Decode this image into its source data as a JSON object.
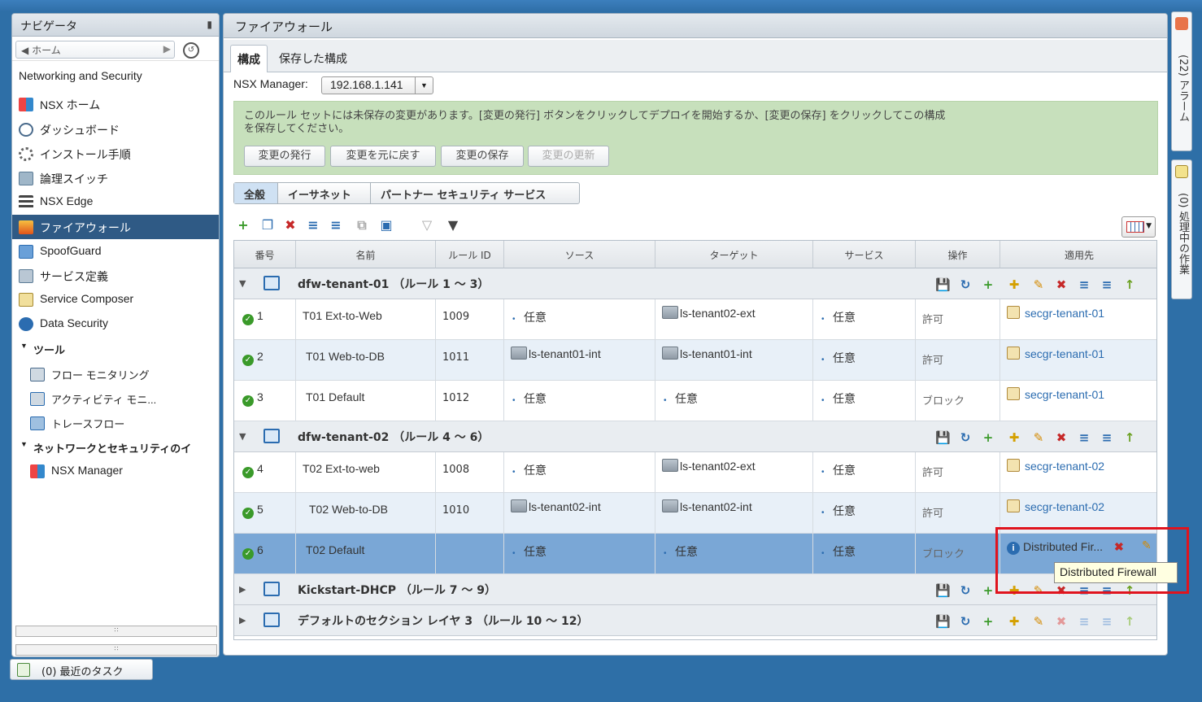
{
  "navigator": {
    "title": "ナビゲータ",
    "home_label": "ホーム",
    "section_title": "Networking and Security",
    "items": [
      {
        "label": "NSX ホーム",
        "icon": "nsx-home-icon"
      },
      {
        "label": "ダッシュボード",
        "icon": "dashboard-icon"
      },
      {
        "label": "インストール手順",
        "icon": "gear-icon"
      },
      {
        "label": "論理スイッチ",
        "icon": "logical-switch-icon"
      },
      {
        "label": "NSX Edge",
        "icon": "nsx-edge-icon"
      },
      {
        "label": "ファイアウォール",
        "icon": "firewall-icon",
        "selected": true
      },
      {
        "label": "SpoofGuard",
        "icon": "spoofguard-icon"
      },
      {
        "label": "サービス定義",
        "icon": "service-definition-icon"
      },
      {
        "label": "Service Composer",
        "icon": "service-composer-icon"
      },
      {
        "label": "Data Security",
        "icon": "data-security-icon"
      }
    ],
    "tools_group": "ツール",
    "tools": [
      {
        "label": "フロー モニタリング",
        "icon": "flow-monitoring-icon"
      },
      {
        "label": "アクティビティ モニ...",
        "icon": "activity-monitoring-icon"
      },
      {
        "label": "トレースフロー",
        "icon": "traceflow-icon"
      }
    ],
    "netsec_group": "ネットワークとセキュリティのイ",
    "netsec_items": [
      {
        "label": "NSX Manager",
        "icon": "nsx-manager-icon"
      }
    ]
  },
  "recent_tasks": "(0) 最近のタスク",
  "main": {
    "title": "ファイアウォール",
    "tabs": [
      {
        "label": "構成",
        "active": true
      },
      {
        "label": "保存した構成"
      }
    ],
    "manager_label": "NSX Manager:",
    "manager_value": "192.168.1.141",
    "banner": {
      "line1": "このルール セットには未保存の変更があります。[変更の発行] ボタンをクリックしてデプロイを開始するか、[変更の保存] をクリックしてこの構成",
      "line2": "を保存してください。",
      "buttons": [
        "変更の発行",
        "変更を元に戻す",
        "変更の保存",
        "変更の更新"
      ]
    },
    "filter_tabs": [
      "全般",
      "イーサネット",
      "パートナー セキュリティ サービス"
    ],
    "columns": [
      "番号",
      "名前",
      "ルール ID",
      "ソース",
      "ターゲット",
      "サービス",
      "操作",
      "適用先"
    ],
    "sections": [
      {
        "title": "dfw-tenant-01 （ルール 1 ～ 3）",
        "expanded": true,
        "rules": [
          {
            "num": "1",
            "name": "T01 Ext-to-Web",
            "id": "1009",
            "source": "任意",
            "source_vm": false,
            "target": "ls-tenant02-ext",
            "target_vm": true,
            "service": "任意",
            "action": "許可",
            "applied": "secgr-tenant-01"
          },
          {
            "num": "2",
            "name": "T01 Web-to-DB",
            "id": "1011",
            "source": "ls-tenant01-int",
            "source_vm": true,
            "target": "ls-tenant01-int",
            "target_vm": true,
            "service": "任意",
            "action": "許可",
            "applied": "secgr-tenant-01"
          },
          {
            "num": "3",
            "name": "T01 Default",
            "id": "1012",
            "source": "任意",
            "source_vm": false,
            "target": "任意",
            "target_vm": false,
            "service": "任意",
            "action": "ブロック",
            "applied": "secgr-tenant-01"
          }
        ]
      },
      {
        "title": "dfw-tenant-02 （ルール 4 ～ 6）",
        "expanded": true,
        "rules": [
          {
            "num": "4",
            "name": "T02 Ext-to-web",
            "id": "1008",
            "source": "任意",
            "source_vm": false,
            "target": "ls-tenant02-ext",
            "target_vm": true,
            "service": "任意",
            "action": "許可",
            "applied": "secgr-tenant-02"
          },
          {
            "num": "5",
            "name": "T02 Web-to-DB",
            "id": "1010",
            "source": "ls-tenant02-int",
            "source_vm": true,
            "target": "ls-tenant02-int",
            "target_vm": true,
            "service": "任意",
            "action": "許可",
            "applied": "secgr-tenant-02"
          },
          {
            "num": "6",
            "name": "T02 Default",
            "id": "",
            "source": "任意",
            "source_vm": false,
            "target": "任意",
            "target_vm": false,
            "service": "任意",
            "action": "ブロック",
            "applied": "Distributed Fir...",
            "selected": true
          }
        ]
      },
      {
        "title": "Kickstart-DHCP （ルール 7 ～ 9）",
        "expanded": false
      },
      {
        "title": "デフォルトのセクション レイヤ 3 （ルール 10 ～ 12）",
        "expanded": false
      }
    ],
    "tooltip": "Distributed Firewall"
  },
  "right_panel": {
    "alarms": "(22) アラーム",
    "work_in_progress": "(0) 処理中の作業"
  }
}
